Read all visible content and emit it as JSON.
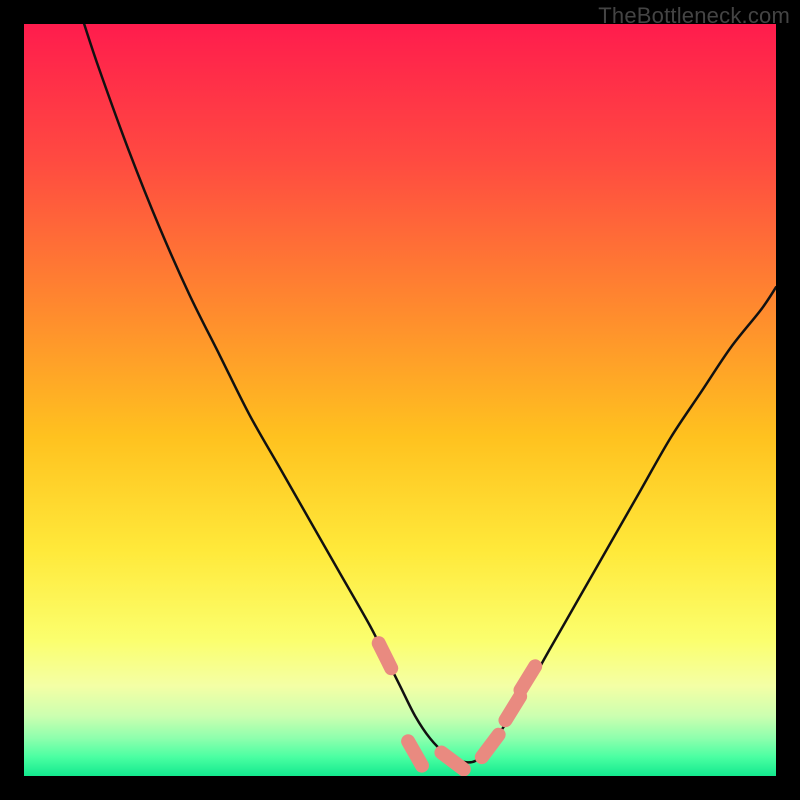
{
  "watermark": "TheBottleneck.com",
  "chart_data": {
    "type": "line",
    "title": "",
    "xlabel": "",
    "ylabel": "",
    "xlim": [
      0,
      100
    ],
    "ylim": [
      0,
      100
    ],
    "grid": false,
    "series": [
      {
        "name": "bottleneck-curve",
        "x": [
          8,
          10,
          14,
          18,
          22,
          26,
          30,
          34,
          38,
          42,
          46,
          48,
          50,
          52,
          54,
          56,
          58,
          60,
          62,
          66,
          70,
          74,
          78,
          82,
          86,
          90,
          94,
          98,
          100
        ],
        "y": [
          100,
          94,
          83,
          73,
          64,
          56,
          48,
          41,
          34,
          27,
          20,
          16,
          12,
          8,
          5,
          3,
          2,
          2,
          4,
          10,
          17,
          24,
          31,
          38,
          45,
          51,
          57,
          62,
          65
        ]
      }
    ],
    "annotations": [
      {
        "name": "valley-marker-left",
        "x": 48,
        "y": 16,
        "color": "#e98a80"
      },
      {
        "name": "valley-marker-mid1",
        "x": 52,
        "y": 3,
        "color": "#e98a80"
      },
      {
        "name": "valley-marker-mid2",
        "x": 57,
        "y": 2,
        "color": "#e98a80"
      },
      {
        "name": "valley-marker-right1",
        "x": 62,
        "y": 4,
        "color": "#e98a80"
      },
      {
        "name": "valley-marker-right2",
        "x": 65,
        "y": 9,
        "color": "#e98a80"
      },
      {
        "name": "valley-marker-right3",
        "x": 67,
        "y": 13,
        "color": "#e98a80"
      }
    ],
    "background_gradient_stops": [
      {
        "pct": 0,
        "color": "#ff1c4d"
      },
      {
        "pct": 18,
        "color": "#ff4a41"
      },
      {
        "pct": 38,
        "color": "#ff8a2e"
      },
      {
        "pct": 55,
        "color": "#ffc21f"
      },
      {
        "pct": 70,
        "color": "#ffe93a"
      },
      {
        "pct": 82,
        "color": "#fbff6e"
      },
      {
        "pct": 88,
        "color": "#f4ffa5"
      },
      {
        "pct": 92,
        "color": "#ccffb0"
      },
      {
        "pct": 95,
        "color": "#8dffad"
      },
      {
        "pct": 97.5,
        "color": "#4affa2"
      },
      {
        "pct": 100,
        "color": "#13e98e"
      }
    ]
  }
}
